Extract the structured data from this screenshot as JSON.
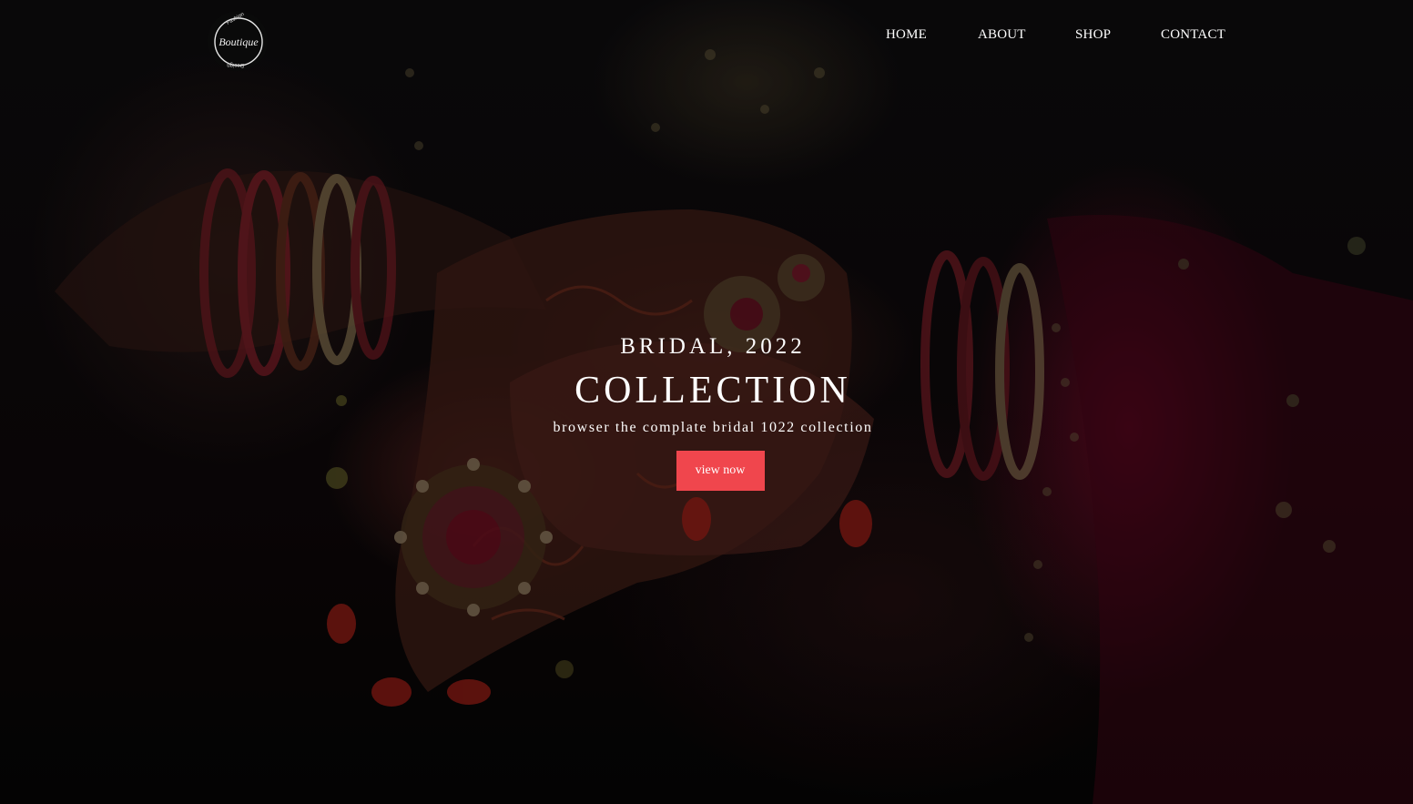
{
  "logo": {
    "text": "Boutique",
    "tagline_top": "Fashion",
    "tagline_bottom": "Design"
  },
  "nav": {
    "items": [
      {
        "label": "HOME"
      },
      {
        "label": "ABOUT"
      },
      {
        "label": "SHOP"
      },
      {
        "label": "CONTACT"
      }
    ]
  },
  "hero": {
    "kicker": "BRIDAL, 2022",
    "title": "COLLECTION",
    "subtitle": "browser the complate bridal 1022 collection",
    "cta_label": "view now"
  },
  "colors": {
    "accent": "#f0464d",
    "text": "#ffffff",
    "background": "#070607"
  }
}
